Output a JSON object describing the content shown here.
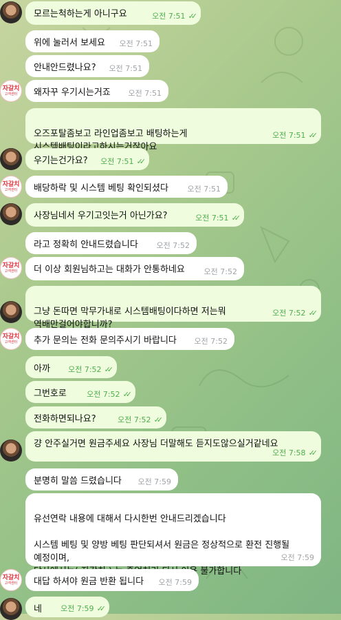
{
  "logo": {
    "line1": "자갈치",
    "line2": "고객센터"
  },
  "messages": [
    {
      "id": "m1",
      "text": "모르는척하는게 아니구요",
      "time": "오전 7:51",
      "dir": "out",
      "check": true
    },
    {
      "id": "m2",
      "text": "위에 눌러서 보세요",
      "time": "오전 7:51",
      "dir": "in"
    },
    {
      "id": "m3",
      "text": "안내안드렸나요?",
      "time": "오전 7:51",
      "dir": "in"
    },
    {
      "id": "m4",
      "text": "왜자꾸 우기시는거죠",
      "time": "오전 7:51",
      "dir": "in"
    },
    {
      "id": "m5",
      "text": "오즈포탈좀보고 라인업좀보고 배팅하는게\n시스템배팅이라고하시는거잖아요",
      "time": "오전 7:51",
      "dir": "out",
      "check": true
    },
    {
      "id": "m6",
      "text": "우기는건가요?",
      "time": "오전 7:51",
      "dir": "out",
      "check": true
    },
    {
      "id": "m7",
      "text": "배당하락 및 시스템 베팅 확인되셨다",
      "time": "오전 7:51",
      "dir": "in"
    },
    {
      "id": "m8",
      "text": "사장님네서 우기고잇는거 아닌가요?",
      "time": "오전 7:51",
      "dir": "out",
      "check": true
    },
    {
      "id": "m9",
      "text": "라고 정확히 안내드렸습니다",
      "time": "오전 7:52",
      "dir": "in"
    },
    {
      "id": "m10",
      "text": "더 이상 회원님하고는 대화가 안통하네요",
      "time": "오전 7:52",
      "dir": "in"
    },
    {
      "id": "m11",
      "text": "그냥 돈따면 막무가내로 시스템배팅이다하면 저는뭐\n역배만걸어야합니까?",
      "time": "오전 7:52",
      "dir": "out",
      "check": true
    },
    {
      "id": "m12",
      "text": "추가 문의는 전화 문의주시기 바랍니다",
      "time": "오전 7:52",
      "dir": "in"
    },
    {
      "id": "m13",
      "text": "아까",
      "time": "오전 7:52",
      "dir": "out",
      "check": true
    },
    {
      "id": "m14",
      "text": "그번호로",
      "time": "오전 7:52",
      "dir": "out",
      "check": true
    },
    {
      "id": "m15",
      "text": "전화하면되나요?",
      "time": "오전 7:52",
      "dir": "out",
      "check": true
    },
    {
      "id": "m16",
      "text": "걍 안주실거면 원금주세요 사장님 더말해도 듣지도않으실거같네요",
      "time": "오전 7:58",
      "dir": "out",
      "check": true
    },
    {
      "id": "m17",
      "text": "분명히 말씀 드렸습니다",
      "time": "오전 7:59",
      "dir": "in"
    },
    {
      "id": "m18",
      "text": "유선연락 내용에 대해서 다시한번 안내드리겠습니다\n\n시스템 베팅 및 양방 베팅 판단되셔서 원금은 정상적으로 환전 진행될\n예정이며,\n당사에서는( 자갈치 ) 는 졸업처리 되서 이용 불가합니다",
      "time": "오전 7:59",
      "dir": "in"
    },
    {
      "id": "m19",
      "text": "대답 하셔야 원금 반환 됩니다",
      "time": "오전 7:59",
      "dir": "in"
    },
    {
      "id": "m20",
      "text": "네",
      "time": "오전 7:59",
      "dir": "out",
      "check": true
    }
  ]
}
